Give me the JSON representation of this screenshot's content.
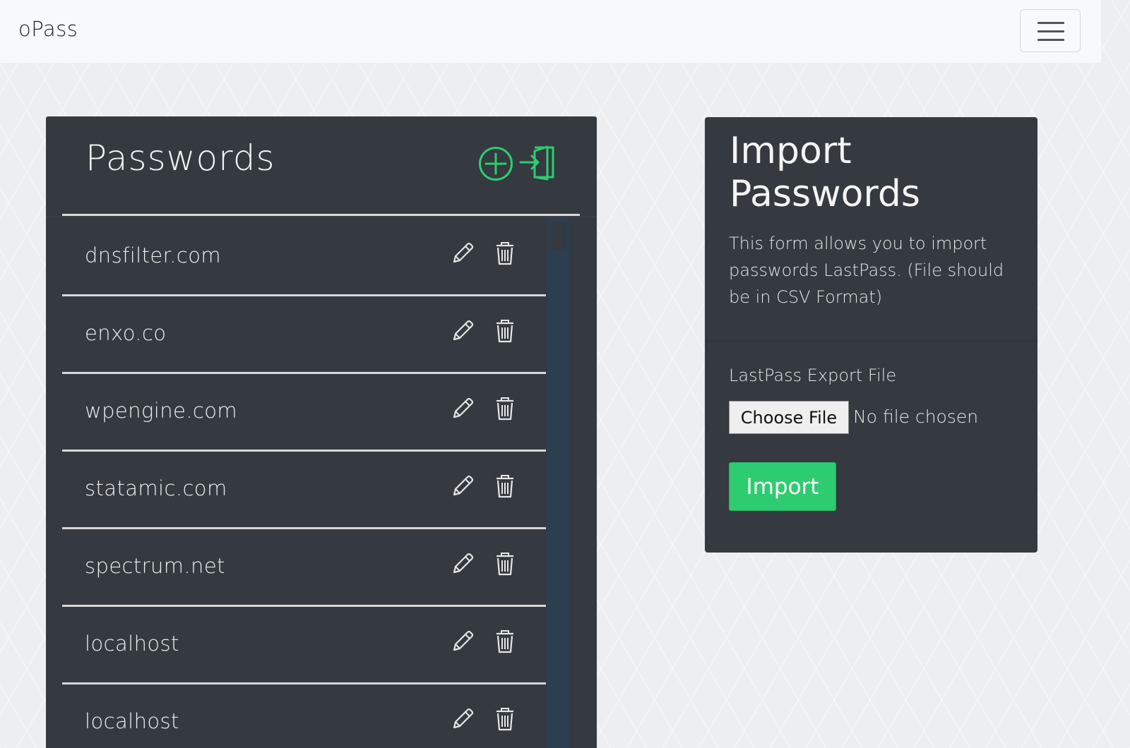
{
  "navbar": {
    "brand": "oPass",
    "toggle_icon": "hamburger-menu-icon"
  },
  "passwords": {
    "title": "Passwords",
    "add_icon": "plus-circle-icon",
    "import_icon": "door-enter-icon",
    "accent_color": "#2ecc71",
    "items": [
      {
        "site": "dnsfilter.com"
      },
      {
        "site": "enxo.co"
      },
      {
        "site": "wpengine.com"
      },
      {
        "site": "statamic.com"
      },
      {
        "site": "spectrum.net"
      },
      {
        "site": "localhost"
      },
      {
        "site": "localhost"
      }
    ],
    "row_icons": {
      "edit": "pencil-icon",
      "delete": "trash-icon"
    }
  },
  "import": {
    "title": "Import Passwords",
    "description": "This form allows you to import passwords LastPass. (File should be in CSV Format)",
    "file_label": "LastPass Export File",
    "file_button": "Choose File",
    "file_status": "No file chosen",
    "submit_label": "Import",
    "submit_color": "#2ecc71"
  }
}
